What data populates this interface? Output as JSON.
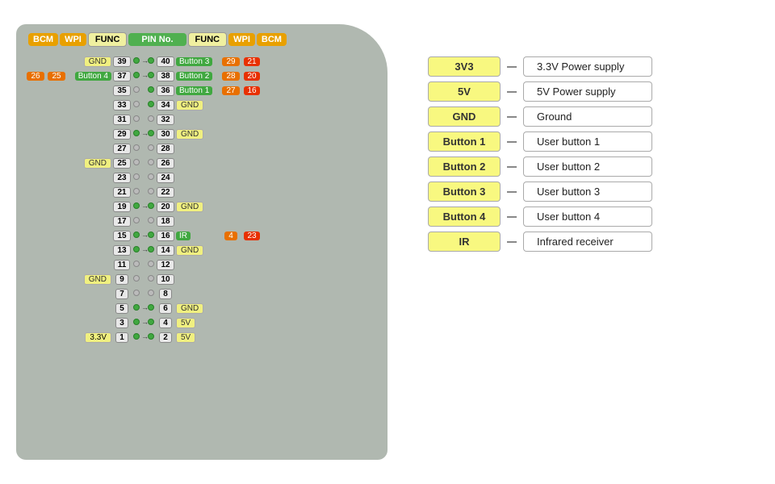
{
  "header": {
    "bcm": "BCM",
    "wpi": "WPI",
    "func": "FUNC",
    "pin_no": "PIN No.",
    "func2": "FUNC",
    "wpi2": "WPI",
    "bcm2": "BCM"
  },
  "legend": [
    {
      "badge": "3V3",
      "label": "3.3V Power supply"
    },
    {
      "badge": "5V",
      "label": "5V Power supply"
    },
    {
      "badge": "GND",
      "label": "Ground"
    },
    {
      "badge": "Button 1",
      "label": "User button 1"
    },
    {
      "badge": "Button 2",
      "label": "User button 2"
    },
    {
      "badge": "Button 3",
      "label": "User button 3"
    },
    {
      "badge": "Button 4",
      "label": "User button 4"
    },
    {
      "badge": "IR",
      "label": "Infrared receiver"
    }
  ],
  "pins": [
    {
      "bcmL": "",
      "wpiL": "",
      "funcL": "GND",
      "pinL": "39",
      "arrow": true,
      "pinR": "40",
      "funcR": "Button 3",
      "wpiR": "29",
      "bcmR": "21"
    },
    {
      "bcmL": "26",
      "wpiL": "25",
      "funcL": "Button 4",
      "pinL": "37",
      "arrow": true,
      "pinR": "38",
      "funcR": "Button 2",
      "wpiR": "28",
      "bcmR": "20"
    },
    {
      "bcmL": "",
      "wpiL": "",
      "funcL": "",
      "pinL": "35",
      "arrow": false,
      "pinR": "36",
      "funcR": "Button 1",
      "wpiR": "27",
      "bcmR": "16"
    },
    {
      "bcmL": "",
      "wpiL": "",
      "funcL": "",
      "pinL": "33",
      "arrow": false,
      "pinR": "34",
      "funcR": "GND",
      "wpiR": "",
      "bcmR": ""
    },
    {
      "bcmL": "",
      "wpiL": "",
      "funcL": "",
      "pinL": "31",
      "arrow": false,
      "pinR": "32",
      "funcR": "",
      "wpiR": "",
      "bcmR": ""
    },
    {
      "bcmL": "",
      "wpiL": "",
      "funcL": "",
      "pinL": "29",
      "arrow": true,
      "pinR": "30",
      "funcR": "GND",
      "wpiR": "",
      "bcmR": ""
    },
    {
      "bcmL": "",
      "wpiL": "",
      "funcL": "",
      "pinL": "27",
      "arrow": false,
      "pinR": "28",
      "funcR": "",
      "wpiR": "",
      "bcmR": ""
    },
    {
      "bcmL": "",
      "wpiL": "",
      "funcL": "GND",
      "pinL": "25",
      "arrow": false,
      "pinR": "26",
      "funcR": "",
      "wpiR": "",
      "bcmR": ""
    },
    {
      "bcmL": "",
      "wpiL": "",
      "funcL": "",
      "pinL": "23",
      "arrow": false,
      "pinR": "24",
      "funcR": "",
      "wpiR": "",
      "bcmR": ""
    },
    {
      "bcmL": "",
      "wpiL": "",
      "funcL": "",
      "pinL": "21",
      "arrow": false,
      "pinR": "22",
      "funcR": "",
      "wpiR": "",
      "bcmR": ""
    },
    {
      "bcmL": "",
      "wpiL": "",
      "funcL": "",
      "pinL": "19",
      "arrow": true,
      "pinR": "20",
      "funcR": "GND",
      "wpiR": "",
      "bcmR": ""
    },
    {
      "bcmL": "",
      "wpiL": "",
      "funcL": "",
      "pinL": "17",
      "arrow": false,
      "pinR": "18",
      "funcR": "",
      "wpiR": "",
      "bcmR": ""
    },
    {
      "bcmL": "",
      "wpiL": "",
      "funcL": "",
      "pinL": "15",
      "arrow": true,
      "pinR": "16",
      "funcR": "IR",
      "wpiR": "4",
      "bcmR": "23"
    },
    {
      "bcmL": "",
      "wpiL": "",
      "funcL": "",
      "pinL": "13",
      "arrow": true,
      "pinR": "14",
      "funcR": "GND",
      "wpiR": "",
      "bcmR": ""
    },
    {
      "bcmL": "",
      "wpiL": "",
      "funcL": "",
      "pinL": "11",
      "arrow": false,
      "pinR": "12",
      "funcR": "",
      "wpiR": "",
      "bcmR": ""
    },
    {
      "bcmL": "",
      "wpiL": "",
      "funcL": "GND",
      "pinL": "9",
      "arrow": false,
      "pinR": "10",
      "funcR": "",
      "wpiR": "",
      "bcmR": ""
    },
    {
      "bcmL": "",
      "wpiL": "",
      "funcL": "",
      "pinL": "7",
      "arrow": false,
      "pinR": "8",
      "funcR": "",
      "wpiR": "",
      "bcmR": ""
    },
    {
      "bcmL": "",
      "wpiL": "",
      "funcL": "",
      "pinL": "5",
      "arrow": true,
      "pinR": "6",
      "funcR": "GND",
      "wpiR": "",
      "bcmR": ""
    },
    {
      "bcmL": "",
      "wpiL": "",
      "funcL": "",
      "pinL": "3",
      "arrow": true,
      "pinR": "4",
      "funcR": "5V",
      "wpiR": "",
      "bcmR": ""
    },
    {
      "bcmL": "",
      "wpiL": "",
      "funcL": "3.3V",
      "pinL": "1",
      "arrow": true,
      "pinR": "2",
      "funcR": "5V",
      "wpiR": "",
      "bcmR": ""
    }
  ]
}
